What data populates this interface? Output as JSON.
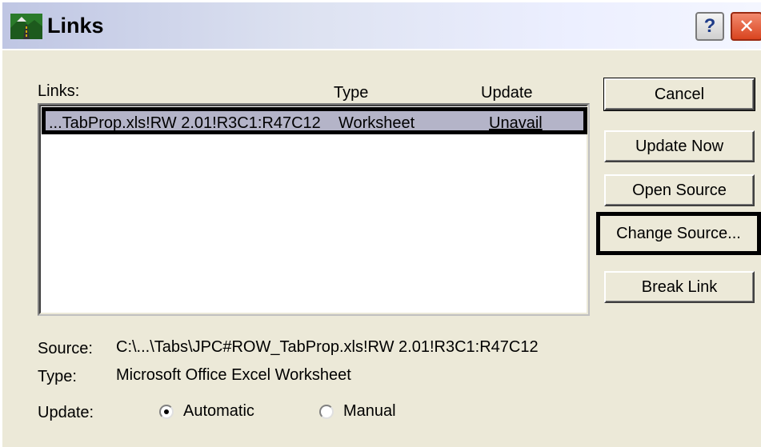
{
  "window": {
    "title": "Links",
    "help_glyph": "?",
    "close_glyph": "✕"
  },
  "list": {
    "headers": {
      "links": "Links:",
      "type": "Type",
      "update": "Update"
    },
    "rows": [
      {
        "link": "...TabProp.xls!RW 2.01!R3C1:R47C12",
        "type": "Worksheet",
        "update": "Unavail"
      }
    ]
  },
  "buttons": {
    "cancel": "Cancel",
    "update_now": "Update Now",
    "open_source": "Open Source",
    "change_source": "Change Source...",
    "break_link": "Break Link"
  },
  "details": {
    "source_label": "Source:",
    "source_value": "C:\\...\\Tabs\\JPC#ROW_TabProp.xls!RW 2.01!R3C1:R47C12",
    "type_label": "Type:",
    "type_value": "Microsoft Office Excel Worksheet",
    "update_label": "Update:",
    "update_options": [
      {
        "label": "Automatic",
        "selected": true
      },
      {
        "label": "Manual",
        "selected": false
      }
    ]
  },
  "colors": {
    "dialog_bg": "#ece9d8",
    "row_highlight": "#b4b4c8",
    "close_red": "#d9441f"
  }
}
